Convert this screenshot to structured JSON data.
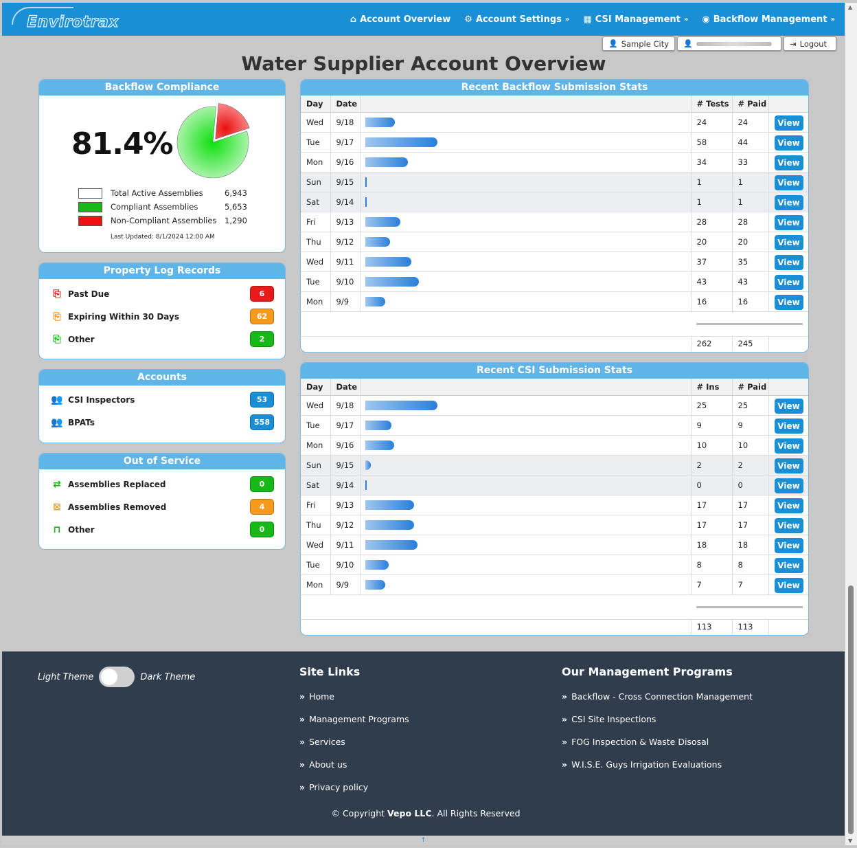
{
  "nav": {
    "logo": "Envirotrax",
    "items": [
      {
        "label": "Account Overview",
        "icon": "home-icon",
        "dropdown": false
      },
      {
        "label": "Account Settings",
        "icon": "gear-icon",
        "dropdown": true
      },
      {
        "label": "CSI Management",
        "icon": "building-search-icon",
        "dropdown": true
      },
      {
        "label": "Backflow Management",
        "icon": "gauge-icon",
        "dropdown": true
      }
    ]
  },
  "userbar": {
    "city": "Sample City",
    "user": "",
    "logout": "Logout"
  },
  "page_title": "Water Supplier Account Overview",
  "compliance": {
    "title": "Backflow Compliance",
    "percent": "81.4%",
    "compliant_fraction": 0.814,
    "colors": {
      "compliant": "#17c217",
      "non_compliant": "#e81a1a"
    },
    "legend": [
      {
        "label": "Total Active Assemblies",
        "value": "6,943",
        "color": "#ffffff"
      },
      {
        "label": "Compliant Assemblies",
        "value": "5,653",
        "color": "#17b817"
      },
      {
        "label": "Non-Compliant Assemblies",
        "value": "1,290",
        "color": "#ee1111"
      }
    ],
    "updated": "Last Updated: 8/1/2024 12:00 AM"
  },
  "property_log": {
    "title": "Property Log Records",
    "items": [
      {
        "label": "Past Due",
        "count": "6",
        "color": "red",
        "icon": "file-alert-icon"
      },
      {
        "label": "Expiring Within 30 Days",
        "count": "62",
        "color": "orange",
        "icon": "file-alert-icon"
      },
      {
        "label": "Other",
        "count": "2",
        "color": "green",
        "icon": "file-alert-icon"
      }
    ]
  },
  "accounts": {
    "title": "Accounts",
    "items": [
      {
        "label": "CSI Inspectors",
        "count": "53",
        "color": "blue",
        "icon": "users-icon"
      },
      {
        "label": "BPATs",
        "count": "558",
        "color": "blue",
        "icon": "users-icon"
      }
    ]
  },
  "out_of_service": {
    "title": "Out of Service",
    "items": [
      {
        "label": "Assemblies Replaced",
        "count": "0",
        "color": "green",
        "icon": "swap-icon"
      },
      {
        "label": "Assemblies Removed",
        "count": "4",
        "color": "orange",
        "icon": "trash-x-icon"
      },
      {
        "label": "Other",
        "count": "0",
        "color": "green",
        "icon": "trash-icon"
      }
    ]
  },
  "backflow_stats": {
    "title": "Recent Backflow Submission Stats",
    "headers": [
      "Day",
      "Date",
      "",
      "# Tests",
      "# Paid",
      ""
    ],
    "view_label": "View",
    "max": 58,
    "rows": [
      {
        "day": "Wed",
        "date": "9/18",
        "n1": "24",
        "n2": "24",
        "v": 24
      },
      {
        "day": "Tue",
        "date": "9/17",
        "n1": "58",
        "n2": "44",
        "v": 58
      },
      {
        "day": "Mon",
        "date": "9/16",
        "n1": "34",
        "n2": "33",
        "v": 34
      },
      {
        "day": "Sun",
        "date": "9/15",
        "n1": "1",
        "n2": "1",
        "v": 1
      },
      {
        "day": "Sat",
        "date": "9/14",
        "n1": "1",
        "n2": "1",
        "v": 1
      },
      {
        "day": "Fri",
        "date": "9/13",
        "n1": "28",
        "n2": "28",
        "v": 28
      },
      {
        "day": "Thu",
        "date": "9/12",
        "n1": "20",
        "n2": "20",
        "v": 20
      },
      {
        "day": "Wed",
        "date": "9/11",
        "n1": "37",
        "n2": "35",
        "v": 37
      },
      {
        "day": "Tue",
        "date": "9/10",
        "n1": "43",
        "n2": "43",
        "v": 43
      },
      {
        "day": "Mon",
        "date": "9/9",
        "n1": "16",
        "n2": "16",
        "v": 16
      }
    ],
    "total1": "262",
    "total2": "245"
  },
  "csi_stats": {
    "title": "Recent CSI Submission Stats",
    "headers": [
      "Day",
      "Date",
      "",
      "# Ins",
      "# Paid",
      ""
    ],
    "view_label": "View",
    "max": 25,
    "rows": [
      {
        "day": "Wed",
        "date": "9/18",
        "n1": "25",
        "n2": "25",
        "v": 25
      },
      {
        "day": "Tue",
        "date": "9/17",
        "n1": "9",
        "n2": "9",
        "v": 9
      },
      {
        "day": "Mon",
        "date": "9/16",
        "n1": "10",
        "n2": "10",
        "v": 10
      },
      {
        "day": "Sun",
        "date": "9/15",
        "n1": "2",
        "n2": "2",
        "v": 2
      },
      {
        "day": "Sat",
        "date": "9/14",
        "n1": "0",
        "n2": "0",
        "v": 0
      },
      {
        "day": "Fri",
        "date": "9/13",
        "n1": "17",
        "n2": "17",
        "v": 17
      },
      {
        "day": "Thu",
        "date": "9/12",
        "n1": "17",
        "n2": "17",
        "v": 17
      },
      {
        "day": "Wed",
        "date": "9/11",
        "n1": "18",
        "n2": "18",
        "v": 18
      },
      {
        "day": "Tue",
        "date": "9/10",
        "n1": "8",
        "n2": "8",
        "v": 8
      },
      {
        "day": "Mon",
        "date": "9/9",
        "n1": "7",
        "n2": "7",
        "v": 7
      }
    ],
    "total1": "113",
    "total2": "113"
  },
  "footer": {
    "theme_light": "Light Theme",
    "theme_dark": "Dark Theme",
    "site_links_title": "Site Links",
    "site_links": [
      "Home",
      "Management Programs",
      "Services",
      "About us",
      "Privacy policy"
    ],
    "programs_title": "Our Management Programs",
    "programs": [
      "Backflow - Cross Connection Management",
      "CSI Site Inspections",
      "FOG Inspection & Waste Disosal",
      "W.I.S.E. Guys Irrigation Evaluations"
    ],
    "copyright_pre": "© Copyright",
    "copyright_company": "Vepo LLC",
    "copyright_post": ". All Rights Reserved"
  }
}
